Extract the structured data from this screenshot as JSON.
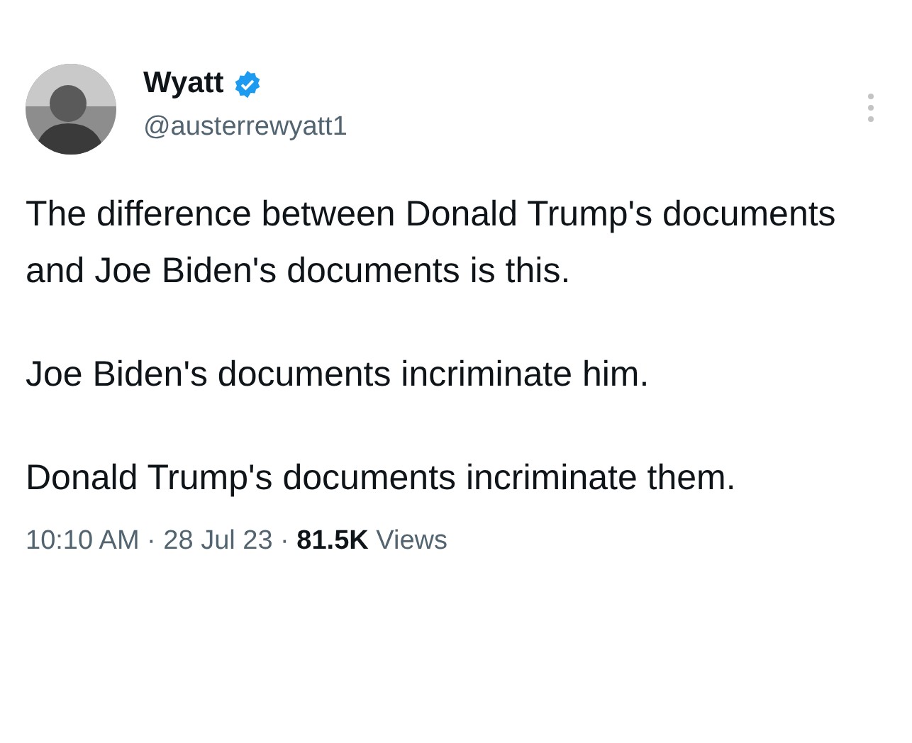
{
  "author": {
    "name": "Wyatt",
    "verified": true,
    "handle": "@austerrewyatt1"
  },
  "paragraphs": [
    "The difference between Donald Trump's documents and Joe Biden's documents is this.",
    "Joe Biden's documents incriminate him.",
    "Donald Trump's documents incriminate them."
  ],
  "meta": "10:10 AM · 28 Jul 23 · **81.5K** Views"
}
